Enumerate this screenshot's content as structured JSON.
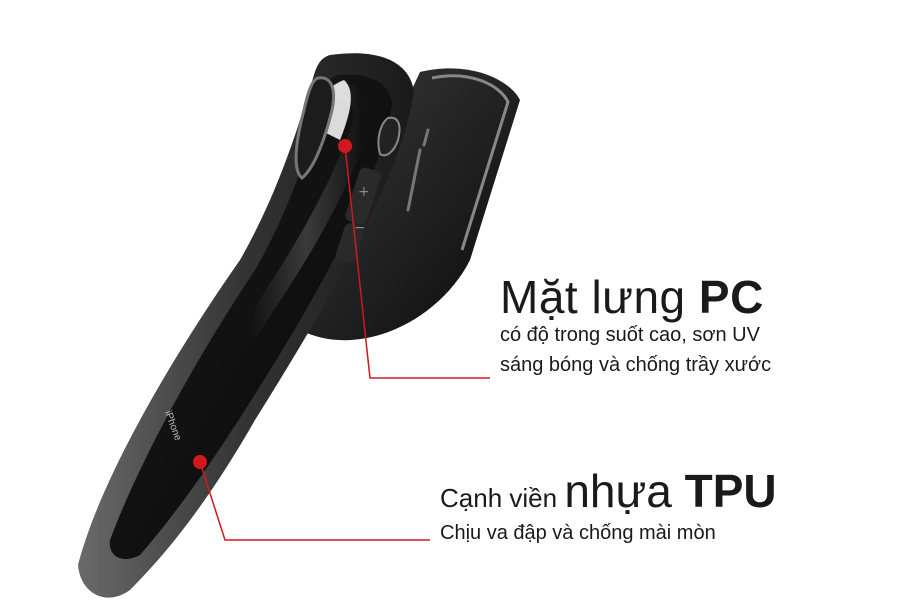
{
  "phone": {
    "engraving": "iPhone"
  },
  "callouts": {
    "pc": {
      "title_prefix": "Mặt lưng ",
      "title_bold": "PC",
      "line1": "có độ trong suốt cao, sơn UV",
      "line2": "sáng bóng và chống trầy xước"
    },
    "tpu": {
      "title_light": "Cạnh viền ",
      "title_medium": "nhựa ",
      "title_bold": "TPU",
      "line1": "Chịu va đập và chống mài mòn"
    }
  },
  "colors": {
    "accent": "#d0181e",
    "case_frame": "#2b2b2b",
    "glass": "#0c0c0c"
  },
  "icons": {
    "pointer_dot": "red-dot",
    "volume_up": "plus",
    "volume_down": "minus"
  }
}
